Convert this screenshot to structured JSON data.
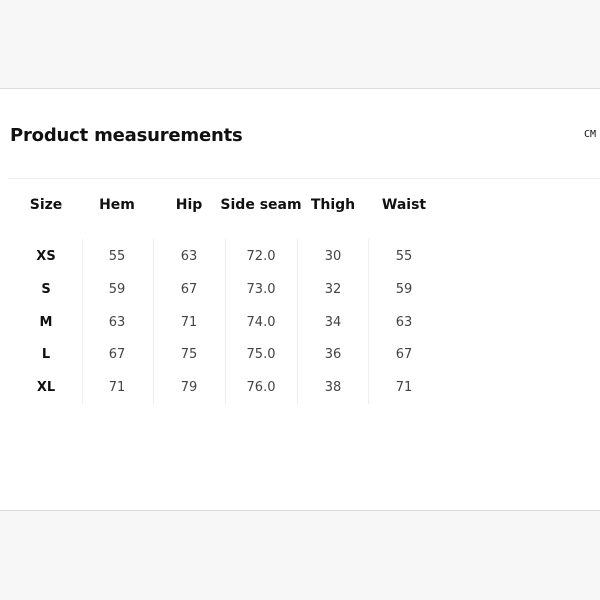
{
  "title": "Product measurements",
  "unit": "CM",
  "columns": [
    "Size",
    "Hem",
    "Hip",
    "Side seam",
    "Thigh",
    "Waist"
  ],
  "rows": [
    {
      "size": "XS",
      "values": [
        "55",
        "63",
        "72.0",
        "30",
        "55"
      ]
    },
    {
      "size": "S",
      "values": [
        "59",
        "67",
        "73.0",
        "32",
        "59"
      ]
    },
    {
      "size": "M",
      "values": [
        "63",
        "71",
        "74.0",
        "34",
        "63"
      ]
    },
    {
      "size": "L",
      "values": [
        "67",
        "75",
        "75.0",
        "36",
        "67"
      ]
    },
    {
      "size": "XL",
      "values": [
        "71",
        "79",
        "76.0",
        "38",
        "71"
      ]
    }
  ]
}
